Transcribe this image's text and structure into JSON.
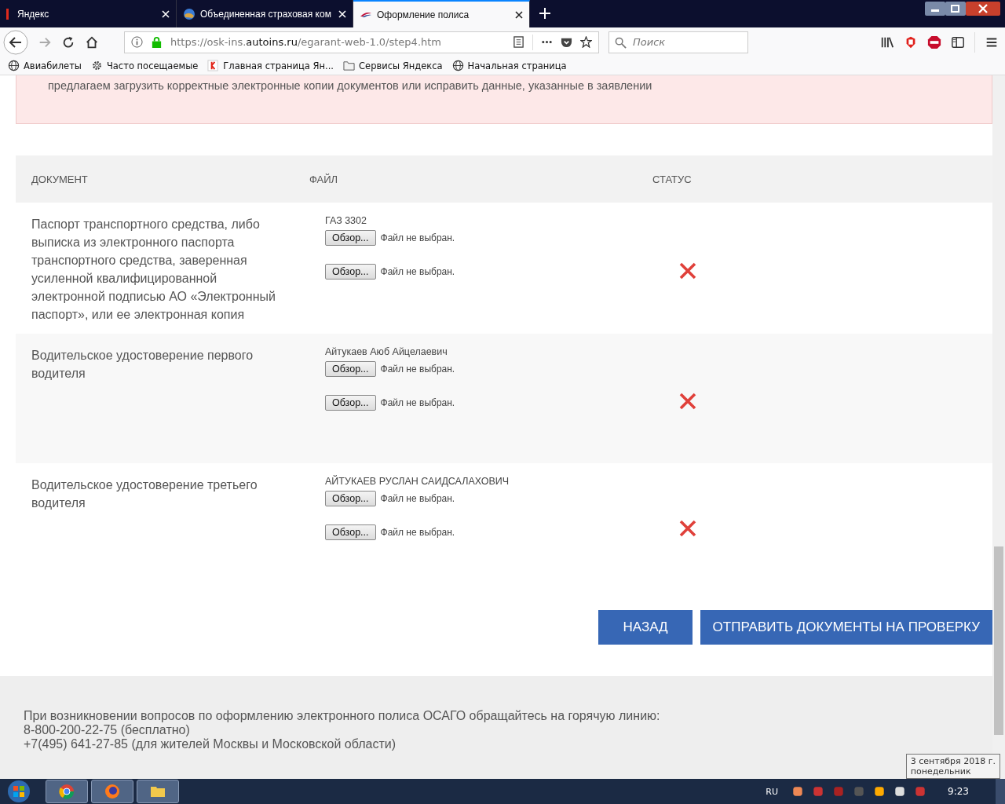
{
  "browser": {
    "tabs": [
      {
        "title": "Яндекс",
        "selected": false
      },
      {
        "title": "Объединенная страховая ком",
        "selected": false
      },
      {
        "title": "Оформление полиса",
        "selected": true
      }
    ],
    "url": {
      "prefix": "https://osk-ins.",
      "domain": "autoins.ru",
      "path": "/egarant-web-1.0/step4.htm"
    },
    "search": {
      "placeholder": "Поиск"
    },
    "bookmarks": [
      {
        "label": "Авиабилеты"
      },
      {
        "label": "Часто посещаемые"
      },
      {
        "label": "Главная страница Ян..."
      },
      {
        "label": "Сервисы Яндекса"
      },
      {
        "label": "Начальная страница"
      }
    ]
  },
  "alert": {
    "text": "предлагаем загрузить корректные электронные копии документов или исправить данные, указанные в заявлении"
  },
  "table": {
    "columns": [
      "ДОКУМЕНТ",
      "ФАЙЛ",
      "СТАТУС"
    ],
    "rows": [
      {
        "document": "Паспорт транспортного средства, либо выписка из электронного паспорта транспортного средства, заверенная усиленной квалифицированной электронной подписью АО «Электронный паспорт», или ее электронная копия",
        "owner": "ГАЗ 3302",
        "files": [
          {
            "button": "Обзор...",
            "status": "Файл не выбран."
          },
          {
            "button": "Обзор...",
            "status": "Файл не выбран."
          }
        ],
        "accepted": false
      },
      {
        "document": "Водительское удостоверение первого водителя",
        "owner": "Айтукаев Аюб Айцелаевич",
        "files": [
          {
            "button": "Обзор...",
            "status": "Файл не выбран."
          },
          {
            "button": "Обзор...",
            "status": "Файл не выбран."
          }
        ],
        "accepted": false
      },
      {
        "document": "Водительское удостоверение третьего водителя",
        "owner": "АЙТУКАЕВ РУСЛАН САИДСАЛАХОВИЧ",
        "files": [
          {
            "button": "Обзор...",
            "status": "Файл не выбран."
          },
          {
            "button": "Обзор...",
            "status": "Файл не выбран."
          }
        ],
        "accepted": false
      }
    ]
  },
  "buttons": [
    "НАЗАД",
    "ОТПРАВИТЬ ДОКУМЕНТЫ НА ПРОВЕРКУ"
  ],
  "footer": [
    "При возникновении вопросов по оформлению электронного полиса ОСАГО обращайтесь на горячую линию:",
    "8-800-200-22-75 (бесплатно)",
    "+7(495) 641-27-85 (для жителей Москвы и Московской области)"
  ],
  "taskbar": {
    "language": "RU",
    "time": "9:23",
    "tooltip": [
      "3 сентября 2018 г.",
      "понедельник"
    ]
  }
}
